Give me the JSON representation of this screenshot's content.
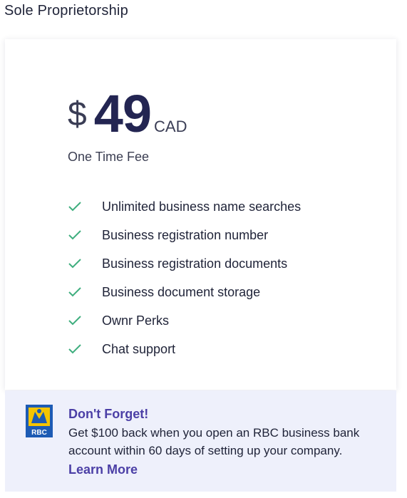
{
  "plan": {
    "title": "Sole Proprietorship"
  },
  "pricing": {
    "currency_symbol": "$",
    "amount": "49",
    "currency": "CAD",
    "fee_label": "One Time Fee"
  },
  "features": [
    {
      "label": "Unlimited business name searches",
      "icon": "check-icon"
    },
    {
      "label": "Business registration number",
      "icon": "check-icon"
    },
    {
      "label": "Business registration documents",
      "icon": "check-icon"
    },
    {
      "label": "Business document storage",
      "icon": "check-icon"
    },
    {
      "label": "Ownr Perks",
      "icon": "check-icon"
    },
    {
      "label": "Chat support",
      "icon": "check-icon"
    }
  ],
  "promo": {
    "logo_text": "RBC",
    "title": "Don't Forget!",
    "text": "Get $100 back when you open an RBC business bank account within 60 days of setting up your company.",
    "link_label": "Learn More"
  },
  "colors": {
    "check": "#3fae7e",
    "accent": "#4b3fa6",
    "price": "#232552",
    "promo_background": "#eef0fb",
    "rbc_blue": "#1d5bb4",
    "rbc_yellow": "#f5c400"
  }
}
